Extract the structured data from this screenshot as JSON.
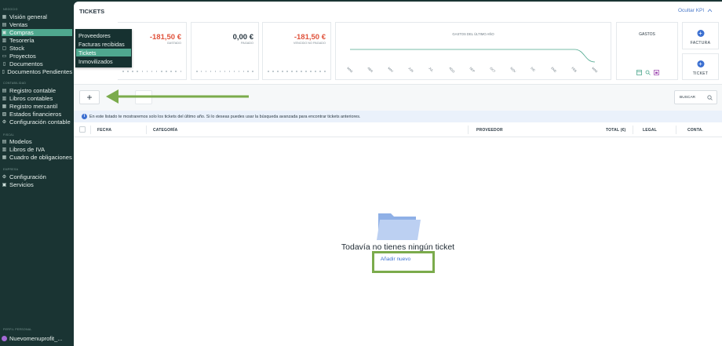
{
  "sidebar": {
    "sections": {
      "negocio": "NEGOCIO",
      "contabilidad": "CONTABILIDAD",
      "fiscal": "FISCAL",
      "empresa": "EMPRESA",
      "perfil": "PERFIL PERSONAL"
    },
    "items": {
      "vision": "Visión general",
      "ventas": "Ventas",
      "compras": "Compras",
      "tesoreria": "Tesorería",
      "stock": "Stock",
      "proyectos": "Proyectos",
      "documentos": "Documentos",
      "documentos_pendientes": "Documentos Pendientes",
      "registro_contable": "Registro contable",
      "libros_contables": "Libros contables",
      "registro_mercantil": "Registro mercantil",
      "estados_financieros": "Estados financieros",
      "configuracion_contable": "Configuración contable",
      "modelos": "Modelos",
      "libros_iva": "Libros de IVA",
      "cuadro_obligaciones": "Cuadro de obligaciones",
      "configuracion": "Configuración",
      "servicios": "Servicios"
    },
    "user": "Nuevomenuprofit_..."
  },
  "submenu": {
    "proveedores": "Proveedores",
    "facturas": "Facturas recibidas",
    "tickets": "Tickets",
    "inmovilizados": "Inmovilizados"
  },
  "header": {
    "title": "TICKETS",
    "hide_kpi": "Ocultar KPI"
  },
  "kpis": {
    "gastado_value": "-181,50 €",
    "gastado_label": "GASTADO",
    "pagado_value": "0,00 €",
    "pagado_label": "PAGADO",
    "vencido_value": "-181,50 €",
    "vencido_label": "VENCIDO NO PAGADO",
    "chart_title": "GASTOS DEL ÚLTIMO AÑO",
    "gastos_label": "GASTOS"
  },
  "chart_data": {
    "type": "line",
    "categories": [
      "MAR",
      "ABR",
      "MAY",
      "JUN",
      "JUL",
      "AGO",
      "SEP",
      "OCT",
      "NOV",
      "DIC",
      "ENE",
      "FEB",
      "MAR"
    ],
    "series": [
      {
        "values": [
          0,
          0,
          0,
          0,
          0,
          0,
          0,
          0,
          0,
          0,
          0,
          0,
          -181.5
        ]
      }
    ],
    "title": "GASTOS DEL ÚLTIMO AÑO",
    "grid": false,
    "colors": [
      "#4fa88f"
    ]
  },
  "actions": {
    "factura": "FACTURA",
    "ticket": "TICKET"
  },
  "toolbar": {
    "add_label": "+",
    "search_label": "BUSCAR"
  },
  "info": {
    "text": "En este listado te mostraremos solo los tickets del último año. Si lo deseas puedes usar la búsqueda avanzada para encontrar tickets anteriores."
  },
  "table": {
    "headers": {
      "fecha": "FECHA",
      "categoria": "CATEGORÍA",
      "proveedor": "PROVEEDOR",
      "total": "TOTAL (€)",
      "legal": "LEGAL",
      "conta": "CONTA."
    }
  },
  "empty": {
    "title": "Todavía no tienes ningún ticket",
    "link": "Añadir nuevo"
  },
  "colors": {
    "sidebar_bg": "#1a3433",
    "accent": "#4fa88f",
    "negative": "#e0533c",
    "link": "#3b6fd1",
    "highlight": "#7bab4c"
  }
}
